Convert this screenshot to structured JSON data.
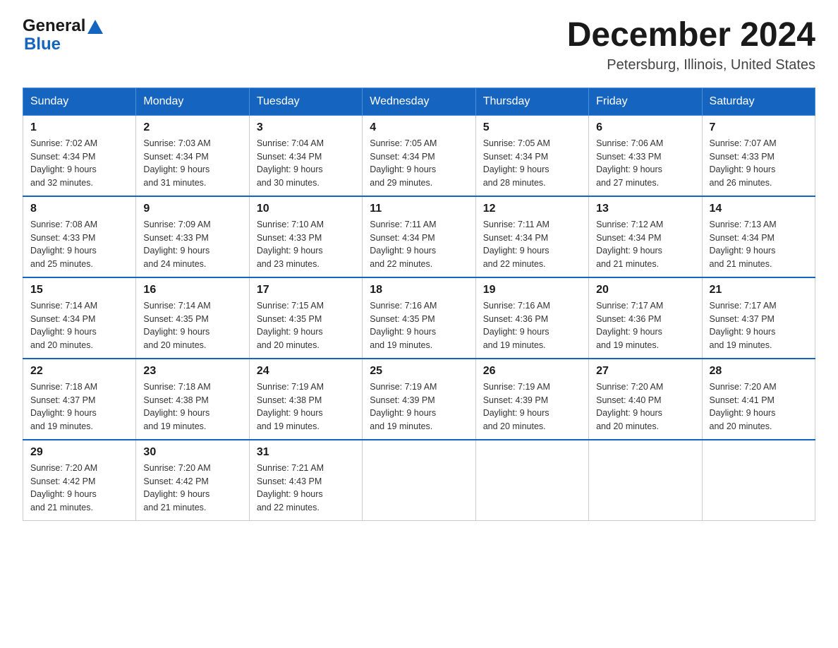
{
  "header": {
    "logo_general": "General",
    "logo_blue": "Blue",
    "title": "December 2024",
    "subtitle": "Petersburg, Illinois, United States"
  },
  "weekdays": [
    "Sunday",
    "Monday",
    "Tuesday",
    "Wednesday",
    "Thursday",
    "Friday",
    "Saturday"
  ],
  "weeks": [
    [
      {
        "day": "1",
        "sunrise": "7:02 AM",
        "sunset": "4:34 PM",
        "daylight": "9 hours and 32 minutes."
      },
      {
        "day": "2",
        "sunrise": "7:03 AM",
        "sunset": "4:34 PM",
        "daylight": "9 hours and 31 minutes."
      },
      {
        "day": "3",
        "sunrise": "7:04 AM",
        "sunset": "4:34 PM",
        "daylight": "9 hours and 30 minutes."
      },
      {
        "day": "4",
        "sunrise": "7:05 AM",
        "sunset": "4:34 PM",
        "daylight": "9 hours and 29 minutes."
      },
      {
        "day": "5",
        "sunrise": "7:05 AM",
        "sunset": "4:34 PM",
        "daylight": "9 hours and 28 minutes."
      },
      {
        "day": "6",
        "sunrise": "7:06 AM",
        "sunset": "4:33 PM",
        "daylight": "9 hours and 27 minutes."
      },
      {
        "day": "7",
        "sunrise": "7:07 AM",
        "sunset": "4:33 PM",
        "daylight": "9 hours and 26 minutes."
      }
    ],
    [
      {
        "day": "8",
        "sunrise": "7:08 AM",
        "sunset": "4:33 PM",
        "daylight": "9 hours and 25 minutes."
      },
      {
        "day": "9",
        "sunrise": "7:09 AM",
        "sunset": "4:33 PM",
        "daylight": "9 hours and 24 minutes."
      },
      {
        "day": "10",
        "sunrise": "7:10 AM",
        "sunset": "4:33 PM",
        "daylight": "9 hours and 23 minutes."
      },
      {
        "day": "11",
        "sunrise": "7:11 AM",
        "sunset": "4:34 PM",
        "daylight": "9 hours and 22 minutes."
      },
      {
        "day": "12",
        "sunrise": "7:11 AM",
        "sunset": "4:34 PM",
        "daylight": "9 hours and 22 minutes."
      },
      {
        "day": "13",
        "sunrise": "7:12 AM",
        "sunset": "4:34 PM",
        "daylight": "9 hours and 21 minutes."
      },
      {
        "day": "14",
        "sunrise": "7:13 AM",
        "sunset": "4:34 PM",
        "daylight": "9 hours and 21 minutes."
      }
    ],
    [
      {
        "day": "15",
        "sunrise": "7:14 AM",
        "sunset": "4:34 PM",
        "daylight": "9 hours and 20 minutes."
      },
      {
        "day": "16",
        "sunrise": "7:14 AM",
        "sunset": "4:35 PM",
        "daylight": "9 hours and 20 minutes."
      },
      {
        "day": "17",
        "sunrise": "7:15 AM",
        "sunset": "4:35 PM",
        "daylight": "9 hours and 20 minutes."
      },
      {
        "day": "18",
        "sunrise": "7:16 AM",
        "sunset": "4:35 PM",
        "daylight": "9 hours and 19 minutes."
      },
      {
        "day": "19",
        "sunrise": "7:16 AM",
        "sunset": "4:36 PM",
        "daylight": "9 hours and 19 minutes."
      },
      {
        "day": "20",
        "sunrise": "7:17 AM",
        "sunset": "4:36 PM",
        "daylight": "9 hours and 19 minutes."
      },
      {
        "day": "21",
        "sunrise": "7:17 AM",
        "sunset": "4:37 PM",
        "daylight": "9 hours and 19 minutes."
      }
    ],
    [
      {
        "day": "22",
        "sunrise": "7:18 AM",
        "sunset": "4:37 PM",
        "daylight": "9 hours and 19 minutes."
      },
      {
        "day": "23",
        "sunrise": "7:18 AM",
        "sunset": "4:38 PM",
        "daylight": "9 hours and 19 minutes."
      },
      {
        "day": "24",
        "sunrise": "7:19 AM",
        "sunset": "4:38 PM",
        "daylight": "9 hours and 19 minutes."
      },
      {
        "day": "25",
        "sunrise": "7:19 AM",
        "sunset": "4:39 PM",
        "daylight": "9 hours and 19 minutes."
      },
      {
        "day": "26",
        "sunrise": "7:19 AM",
        "sunset": "4:39 PM",
        "daylight": "9 hours and 20 minutes."
      },
      {
        "day": "27",
        "sunrise": "7:20 AM",
        "sunset": "4:40 PM",
        "daylight": "9 hours and 20 minutes."
      },
      {
        "day": "28",
        "sunrise": "7:20 AM",
        "sunset": "4:41 PM",
        "daylight": "9 hours and 20 minutes."
      }
    ],
    [
      {
        "day": "29",
        "sunrise": "7:20 AM",
        "sunset": "4:42 PM",
        "daylight": "9 hours and 21 minutes."
      },
      {
        "day": "30",
        "sunrise": "7:20 AM",
        "sunset": "4:42 PM",
        "daylight": "9 hours and 21 minutes."
      },
      {
        "day": "31",
        "sunrise": "7:21 AM",
        "sunset": "4:43 PM",
        "daylight": "9 hours and 22 minutes."
      },
      null,
      null,
      null,
      null
    ]
  ],
  "labels": {
    "sunrise": "Sunrise:",
    "sunset": "Sunset:",
    "daylight": "Daylight:"
  }
}
